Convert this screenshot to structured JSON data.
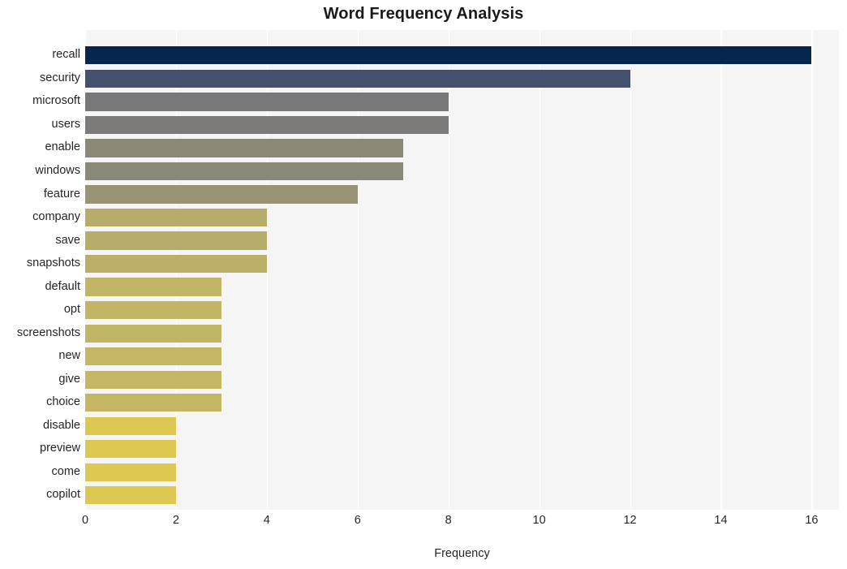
{
  "chart_data": {
    "type": "bar",
    "orientation": "horizontal",
    "title": "Word Frequency Analysis",
    "xlabel": "Frequency",
    "ylabel": "",
    "xlim": [
      0,
      16.6
    ],
    "ylim": [
      0,
      20
    ],
    "grid": "vertical-white-gridlines",
    "legend": "none",
    "x_ticks": [
      "0",
      "2",
      "4",
      "6",
      "8",
      "10",
      "12",
      "14",
      "16"
    ],
    "x_tick_values": [
      0,
      2,
      4,
      6,
      8,
      10,
      12,
      14,
      16
    ],
    "categories": [
      "recall",
      "security",
      "microsoft",
      "users",
      "enable",
      "windows",
      "feature",
      "company",
      "save",
      "snapshots",
      "default",
      "opt",
      "screenshots",
      "new",
      "give",
      "choice",
      "disable",
      "preview",
      "come",
      "copilot"
    ],
    "values": [
      16,
      12,
      8,
      8,
      7,
      7,
      6,
      4,
      4,
      4,
      3,
      3,
      3,
      3,
      3,
      3,
      2,
      2,
      2,
      2
    ],
    "bar_colors": [
      "#06254f",
      "#454f6e",
      "#78787a",
      "#7c7b79",
      "#8b8878",
      "#8a8878",
      "#999275",
      "#b8ac6a",
      "#b8ac6a",
      "#bbae69",
      "#c2b465",
      "#c2b465",
      "#c2b465",
      "#c5b663",
      "#c5b663",
      "#c5b663",
      "#ddc851",
      "#ddc851",
      "#ddc851",
      "#ddc851"
    ],
    "plot_background": "#f5f5f6",
    "figure_background": "#ffffff"
  }
}
